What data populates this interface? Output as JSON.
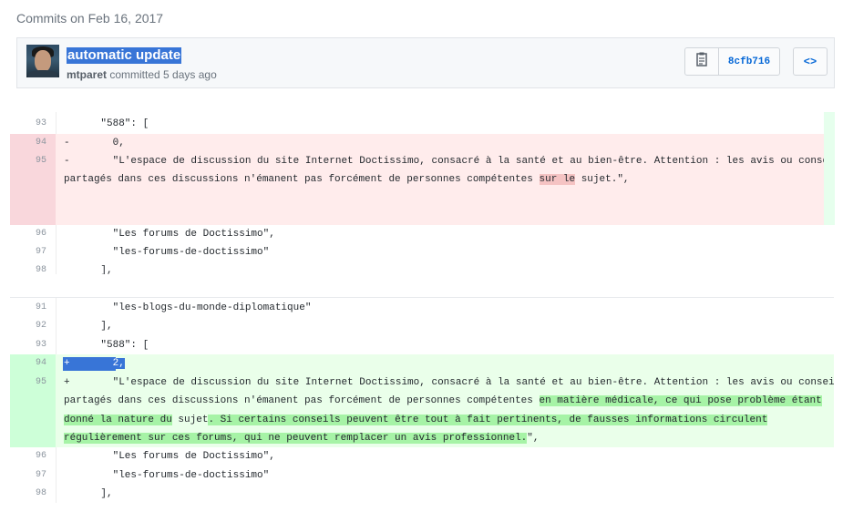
{
  "commits_heading": "Commits on Feb 16, 2017",
  "commit": {
    "title": "automatic update",
    "author": "mtparet",
    "meta_suffix": " committed 5 days ago",
    "sha": "8cfb716",
    "browse_label": "<>"
  },
  "icons": {
    "copy": "clipboard-icon",
    "browse": "code-brackets-icon"
  },
  "colors": {
    "deleted_bg": "#ffecec",
    "added_bg": "#eaffea",
    "selection": "#3875d7",
    "link": "#0366d6"
  },
  "diff_old": {
    "lines": [
      {
        "num": "93",
        "code": "    \"588\": ["
      },
      {
        "num": "94",
        "marker": "-",
        "code": "      0,"
      },
      {
        "num": "95",
        "marker": "-",
        "code_a": "      \"L'espace de discussion du site Internet Doctissimo, consacré à la santé et au bien-être. Attention : les avis ou conseils",
        "code_b1": "partagés dans ces discussions n'émanent pas forcément de personnes compétentes ",
        "code_b_hl": "sur le",
        "code_b2": " sujet.\","
      },
      {
        "num": "96",
        "code": "      \"Les forums de Doctissimo\","
      },
      {
        "num": "97",
        "code": "      \"les-forums-de-doctissimo\""
      },
      {
        "num": "98",
        "code": "    ],"
      }
    ]
  },
  "diff_new": {
    "lines": [
      {
        "num": "91",
        "code": "      \"les-blogs-du-monde-diplomatique\""
      },
      {
        "num": "92",
        "code": "    ],"
      },
      {
        "num": "93",
        "code": "    \"588\": ["
      },
      {
        "num": "94",
        "marker": "+",
        "code": "      2,"
      },
      {
        "num": "95",
        "marker": "+",
        "code_a": "      \"L'espace de discussion du site Internet Doctissimo, consacré à la santé et au bien-être. Attention : les avis ou conseils",
        "code_b1": "partagés dans ces discussions n'émanent pas forcément de personnes compétentes ",
        "code_b_hl": "en matière médicale, ce qui pose problème étant",
        "code_c_hl1": "donné la nature du",
        "code_c2": " sujet",
        "code_c_hl2": ". Si certains conseils peuvent être tout à fait pertinents, de fausses informations circulent",
        "code_d_hl": "régulièrement sur ces forums, qui ne peuvent remplacer un avis professionnel.",
        "code_d2": "\","
      },
      {
        "num": "96",
        "code": "      \"Les forums de Doctissimo\","
      },
      {
        "num": "97",
        "code": "      \"les-forums-de-doctissimo\""
      },
      {
        "num": "98",
        "code": "    ],"
      }
    ]
  }
}
